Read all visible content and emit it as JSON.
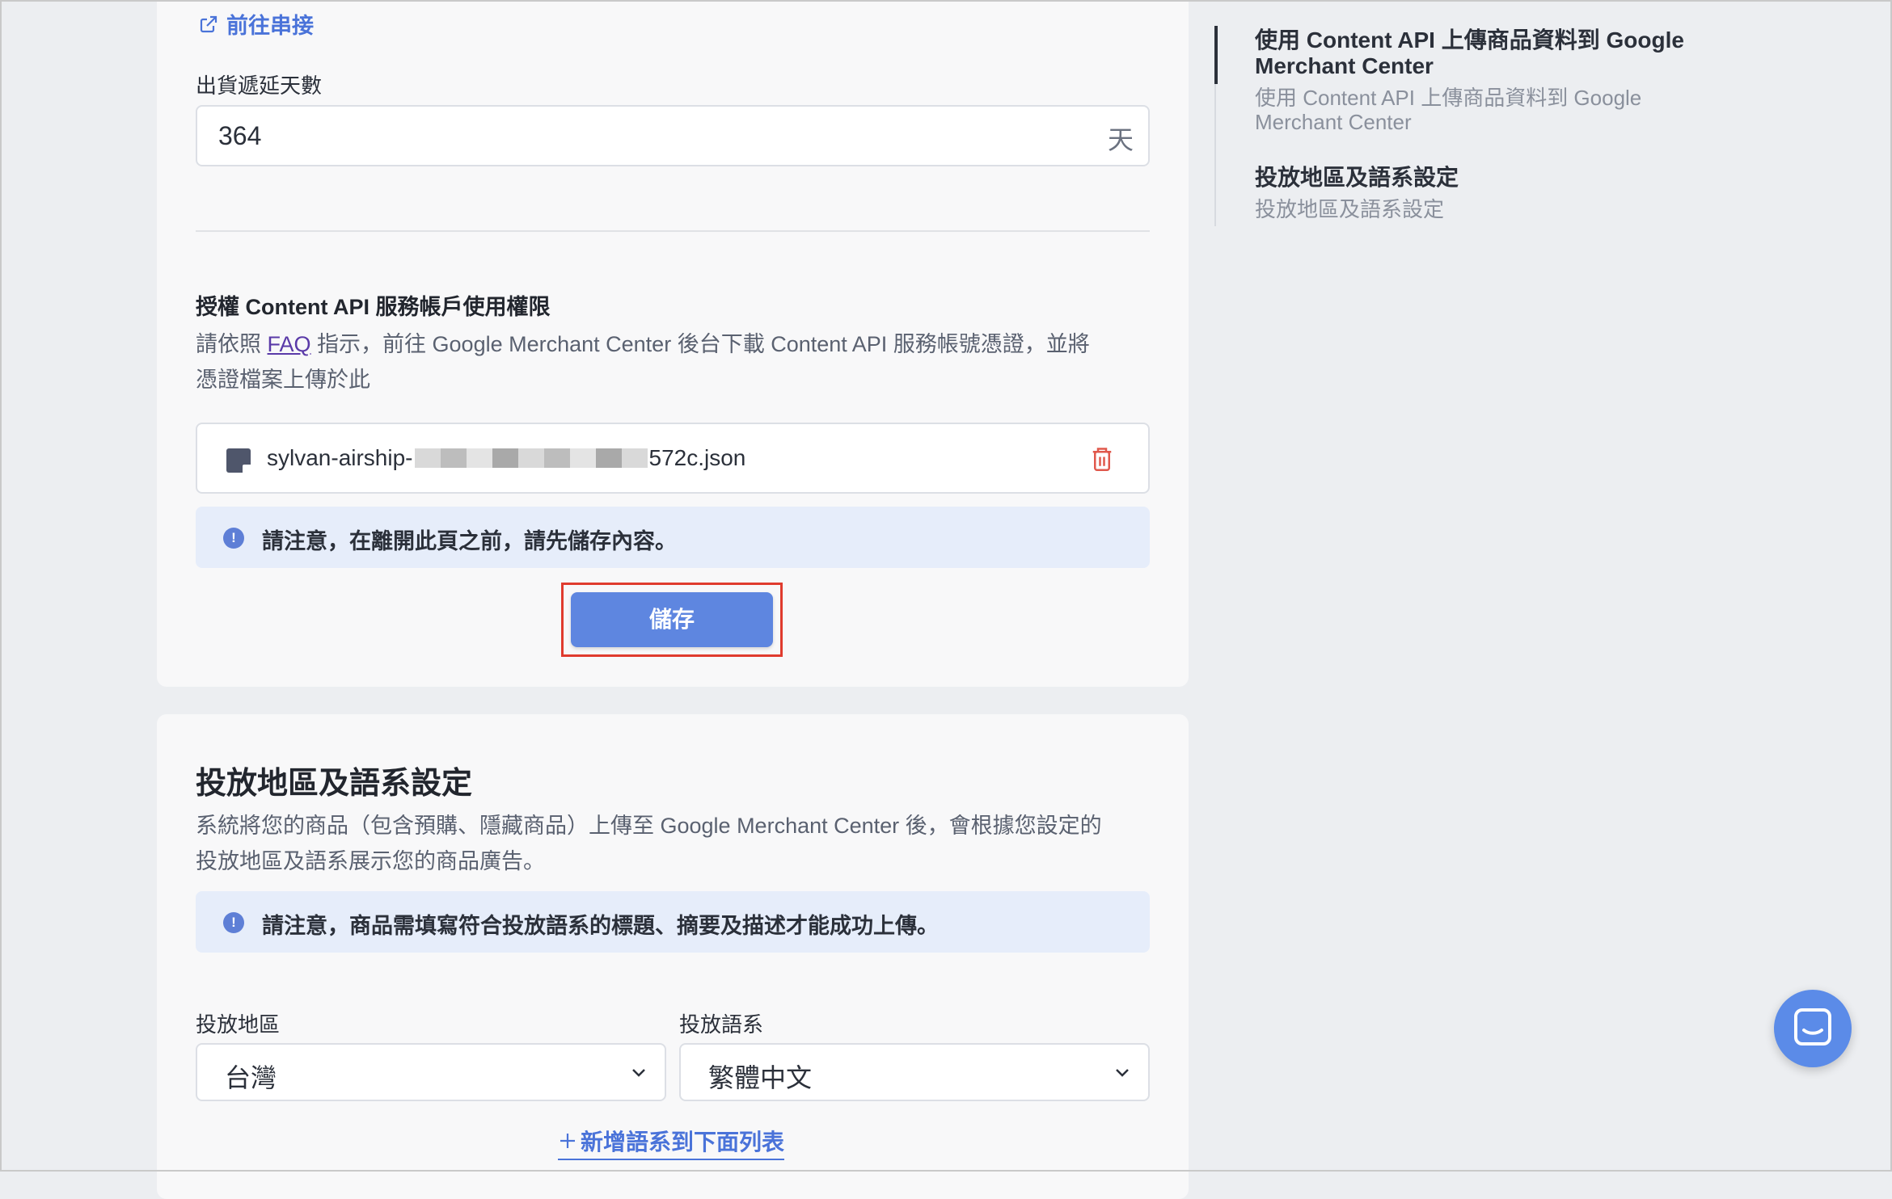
{
  "card1": {
    "connect_link": "前往串接",
    "delay_label": "出貨遞延天數",
    "delay_value": "364",
    "delay_unit": "天",
    "auth_title": "授權 Content API 服務帳戶使用權限",
    "auth_desc_prefix": "請依照 ",
    "auth_desc_link": "FAQ",
    "auth_desc_line1_suffix": " 指示，前往 Google Merchant Center 後台下載 Content API 服務帳號憑證，並將",
    "auth_desc_line2": "憑證檔案上傳於此",
    "file_name_prefix": "sylvan-airship-",
    "file_name_suffix": "572c.json",
    "notice": "請注意，在離開此頁之前，請先儲存內容。",
    "save_label": "儲存"
  },
  "card2": {
    "title": "投放地區及語系設定",
    "desc_line1": "系統將您的商品（包含預購、隱藏商品）上傳至 Google Merchant Center 後，會根據您設定的",
    "desc_line2": "投放地區及語系展示您的商品廣告。",
    "notice": "請注意，商品需填寫符合投放語系的標題、摘要及描述才能成功上傳。",
    "region_label": "投放地區",
    "region_value": "台灣",
    "language_label": "投放語系",
    "language_value": "繁體中文",
    "add_language_link": "新增語系到下面列表"
  },
  "toc": {
    "items": [
      {
        "title": "使用 Content API 上傳商品資料到 Google Merchant Center",
        "subtitle": "使用 Content API 上傳商品資料到 Google Merchant Center"
      },
      {
        "title": "投放地區及語系設定",
        "subtitle": "投放地區及語系設定"
      }
    ]
  },
  "colors": {
    "accent": "#5e86e0",
    "highlight": "#e03b2e",
    "notice_bg": "#e6edfa"
  },
  "icons": [
    "external-link-icon",
    "file-icon",
    "trash-icon",
    "info-icon",
    "chevron-down-icon",
    "plus-icon",
    "chat-icon"
  ]
}
